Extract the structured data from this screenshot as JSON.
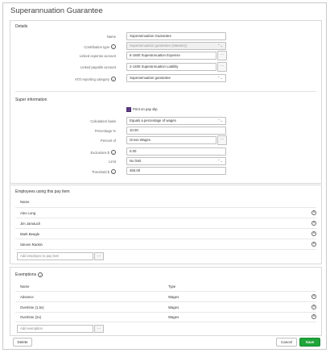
{
  "dialog": {
    "title": "Superannuation Guarantee"
  },
  "details": {
    "title": "Details",
    "name_label": "Name",
    "name_value": "Superannuation Guarantee",
    "contribution_type_label": "Contribution type",
    "contribution_type_value": "Superannuation guarantee (statutory)",
    "linked_expense_label": "Linked expense account",
    "linked_expense_value": "6-1600 Superannuation Expense",
    "linked_payable_label": "Linked payable account",
    "linked_payable_value": "2-1400 Superannuation Liability",
    "ato_label": "ATO reporting category",
    "ato_value": "Superannuation guarantee"
  },
  "super_info": {
    "title": "Super information",
    "print_label": "Print on pay slip",
    "calc_basis_label": "Calculation basis",
    "calc_basis_value": "Equals a percentage of wages",
    "percentage_label": "Percentage %",
    "percentage_value": "10.00",
    "percent_of_label": "Percent of",
    "percent_of_value": "Gross Wages",
    "exclusions_label": "Exclusions $",
    "exclusions_value": "0.00",
    "limit_label": "Limit",
    "limit_value": "No limit",
    "threshold_label": "Threshold $",
    "threshold_value": "450.00"
  },
  "employees": {
    "title": "Employees using this pay item",
    "col_name": "Name",
    "rows": [
      "Alex Long",
      "Jim Jamauch",
      "Mark Beagle",
      "Steven Rankin"
    ],
    "add_placeholder": "Add employee to pay item"
  },
  "exemptions": {
    "title": "Exemptions",
    "col_name": "Name",
    "col_type": "Type",
    "rows": [
      {
        "name": "Advance",
        "type": "Wages"
      },
      {
        "name": "Overtime (1.5x)",
        "type": "Wages"
      },
      {
        "name": "Overtime (2x)",
        "type": "Wages"
      }
    ],
    "add_placeholder": "Add exemption"
  },
  "footer": {
    "delete": "Delete",
    "cancel": "Cancel",
    "save": "Save"
  },
  "colors": {
    "save": "#1fa53a",
    "checkbox": "#5e3a86"
  }
}
